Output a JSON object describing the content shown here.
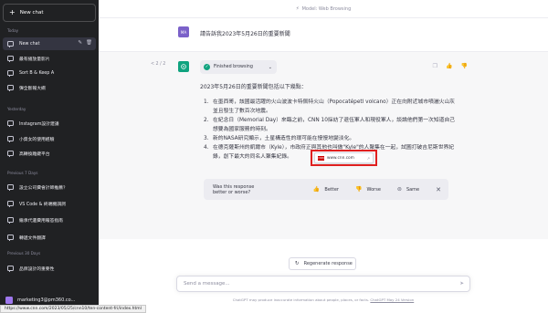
{
  "sidebar": {
    "new_chat": "New chat",
    "sections": [
      {
        "label": "Today"
      },
      {
        "label": "Yesterday"
      },
      {
        "label": "Previous 7 Days"
      },
      {
        "label": "Previous 30 Days"
      }
    ],
    "items": [
      {
        "label": "New chat"
      },
      {
        "label": "最有播放量影片"
      },
      {
        "label": "Sort B & Keep A"
      },
      {
        "label": "彈全斷報大綱"
      },
      {
        "label": "Instagram設計建議"
      },
      {
        "label": "小資女的使用經驗"
      },
      {
        "label": "高轉換雛鍵平台"
      },
      {
        "label": "設立公司費會計師推薦？"
      },
      {
        "label": "VS Code & 終端機調詞"
      },
      {
        "label": "繼承代遺費用報答指南"
      },
      {
        "label": "轉遞文件翻譯"
      },
      {
        "label": "品牌設計的重要性"
      }
    ],
    "user": "marketing3@pm360.co..."
  },
  "topbar": {
    "title": "Model: Web Browsing"
  },
  "conversation": {
    "user_avatar": "MA",
    "user_message": "請告訴我2023年5月26日的重要新聞",
    "pager": "< 2 / 2",
    "browse_status": "Finished browsing",
    "intro": "2023年5月26日的重要新聞包括以下幾點：",
    "news": [
      {
        "num": "1.",
        "text": "在墨西哥，該國最活躍的火山波波卡特佩特火山（Popocatépetl volcano）正在向附近城市噴灑火山灰並且發生了數百次地震。"
      },
      {
        "num": "2.",
        "text": "在紀念日（Memorial Day）來臨之前，CNN 10採訪了退伍軍人和現役軍人，談論他們第一次知道自己想要為國家服務的時刻。"
      },
      {
        "num": "3.",
        "text": "新的NASA研究顯示，土星構造性的環可能在慢慢地變淡化。"
      },
      {
        "num": "4.",
        "text": "在德克薩斯州的凱爾市（Kyle），市政府正與其他也叫做\"Kyle\"的人聚集在一起，試圖打破吉尼斯世界紀錄，創下最大的同名人聚集紀錄。"
      }
    ],
    "source_chip": "www.cnn.com",
    "feedback": {
      "question": "Was this response better or worse?",
      "better": "Better",
      "worse": "Worse",
      "same": "Same"
    }
  },
  "composer": {
    "regenerate": "Regenerate response",
    "placeholder": "Send a message...",
    "disclaimer": "ChatGPT may produce inaccurate information about people, places, or facts.",
    "version": "ChatGPT May 24 Version"
  },
  "status_bar": {
    "url": "https://www.cnn.com/2023/05/25/cnn10/ten-content-fri/index.html"
  },
  "colors": {
    "accent": "#10a37f",
    "highlight": "#e02020",
    "sidebar": "#202123"
  }
}
